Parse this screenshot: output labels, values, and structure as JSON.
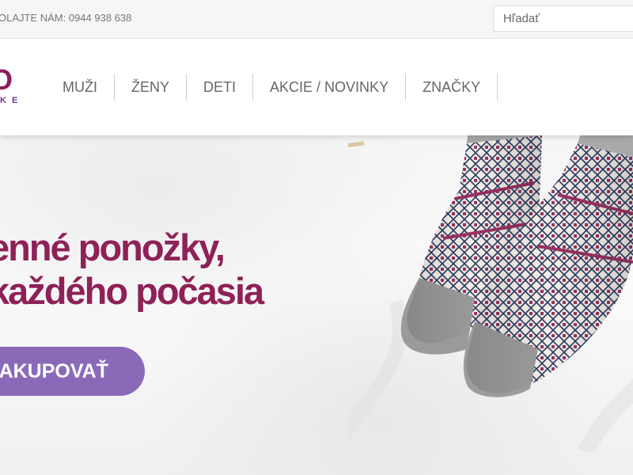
{
  "topbar": {
    "phone_text": "OLAJTE NÁM: 0944 938 638",
    "search_placeholder": "Hľadať"
  },
  "logo": {
    "mark": "O",
    "sub": "KE"
  },
  "nav": {
    "items": [
      {
        "label": "MUŽI"
      },
      {
        "label": "ŽENY"
      },
      {
        "label": "DETI"
      },
      {
        "label": "AKCIE / NOVINKY"
      },
      {
        "label": "ZNAČKY"
      }
    ]
  },
  "hero": {
    "headline_line1": "enné ponožky,",
    "headline_line2": "každého počasia",
    "cta_label": "AKUPOVAŤ"
  },
  "colors": {
    "brand": "#8e2158",
    "cta": "#8a6ab8",
    "text_muted": "#666666"
  }
}
